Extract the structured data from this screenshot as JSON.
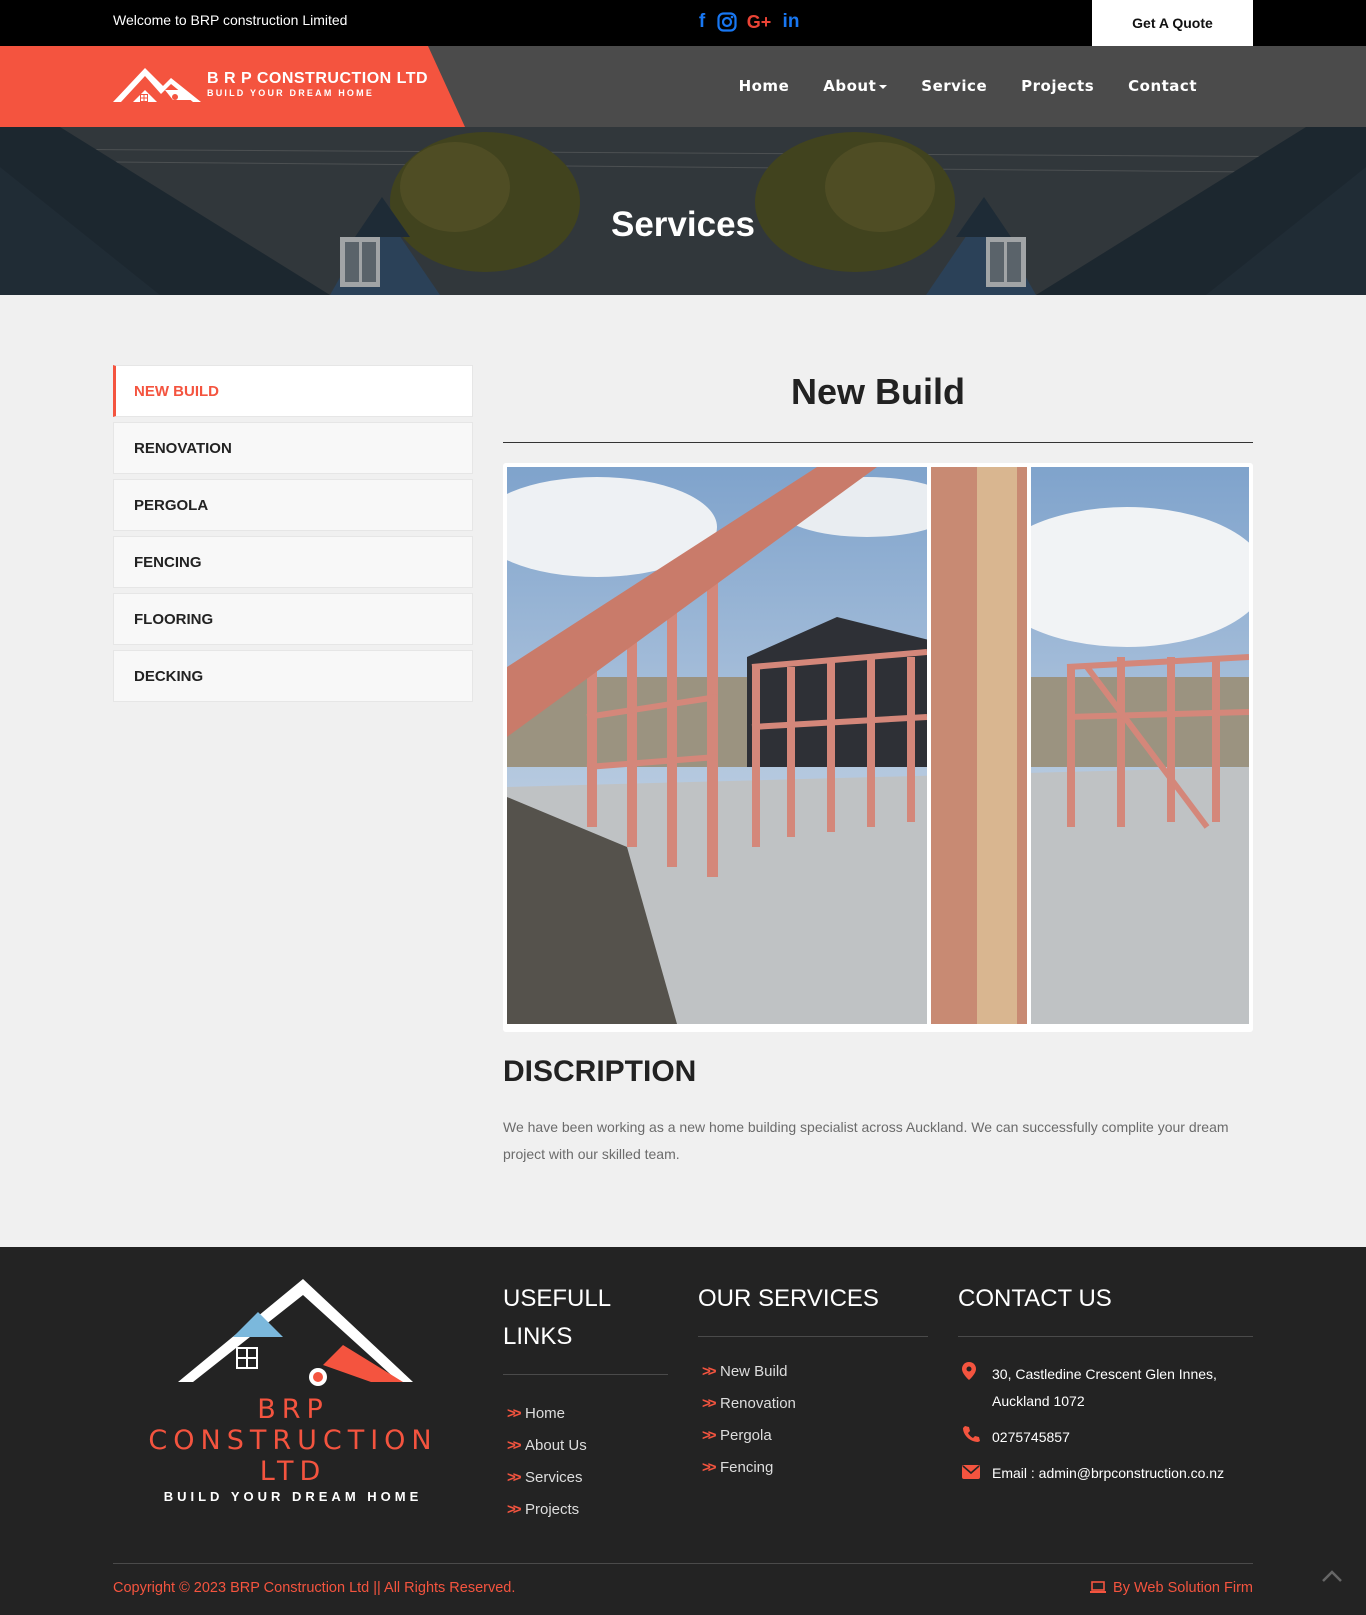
{
  "topbar": {
    "welcome": "Welcome to BRP construction Limited",
    "socials": [
      "facebook-icon",
      "instagram-icon",
      "google-plus-icon",
      "linkedin-icon"
    ],
    "google_plus": "G+",
    "linkedin": "in",
    "facebook": "f",
    "quote_button": "Get A Quote"
  },
  "brand": {
    "name": "B R P CONSTRUCTION LTD",
    "tagline": "BUILD YOUR DREAM HOME",
    "footer_name": "BRP CONSTRUCTION LTD",
    "footer_tagline": "BUILD YOUR DREAM HOME"
  },
  "nav": {
    "items": [
      "Home",
      "About",
      "Service",
      "Projects",
      "Contact"
    ]
  },
  "hero": {
    "title": "Services"
  },
  "sidebar": {
    "items": [
      "NEW BUILD",
      "RENOVATION",
      "PERGOLA",
      "FENCING",
      "FLOORING",
      "DECKING"
    ],
    "active": "NEW BUILD"
  },
  "main": {
    "title": "New Build",
    "desc_heading": "DISCRIPTION",
    "desc_text": "We have been working as a new home building specialist across Auckland. We can successfully complite your dream project with our skilled team."
  },
  "footer": {
    "links_heading_1": "USEFULL",
    "links_heading_2": "LINKS",
    "links": [
      "Home",
      "About Us",
      "Services",
      "Projects"
    ],
    "services_heading": "OUR SERVICES",
    "services": [
      "New Build",
      "Renovation",
      "Pergola",
      "Fencing"
    ],
    "contact_heading": "CONTACT US",
    "address": "30, Castledine Crescent Glen Innes, Auckland 1072",
    "phone": "0275745857",
    "email": "Email : admin@brpconstruction.co.nz",
    "copyright": "Copyright © 2023 BRP Construction Ltd || All Rights Reserved.",
    "byline": "By Web Solution Firm"
  },
  "colors": {
    "accent": "#f4543f",
    "nav_bg": "#4b4b4b",
    "footer_bg": "#232323"
  }
}
